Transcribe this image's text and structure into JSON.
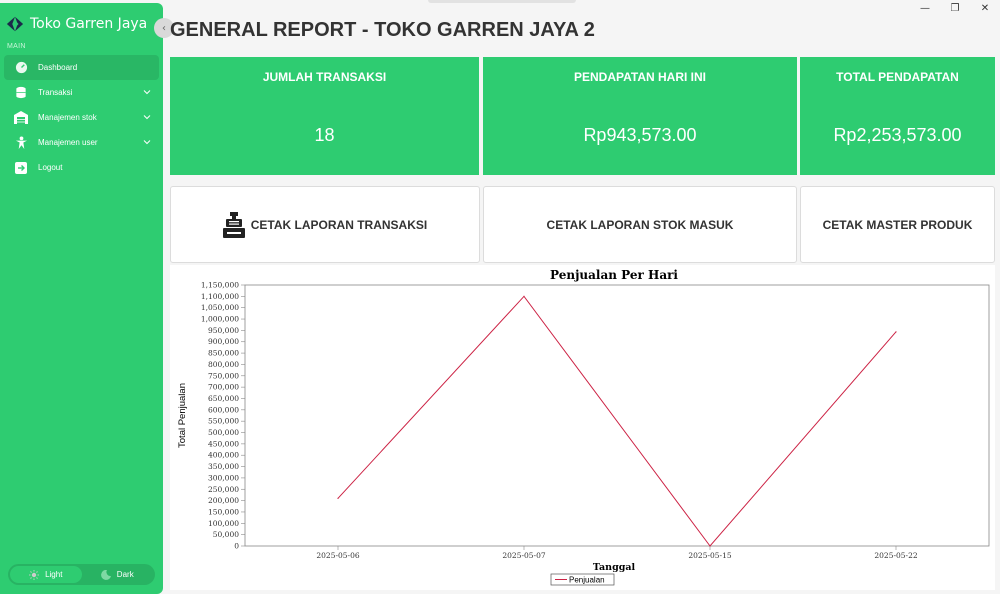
{
  "window": {
    "minimize": "—",
    "restore": "❐",
    "close": "✕"
  },
  "sidebar": {
    "brand": "Toko Garren Jaya",
    "section_label": "MAIN",
    "items": [
      {
        "label": "Dashboard",
        "icon": "dashboard-icon"
      },
      {
        "label": "Transaksi",
        "icon": "database-icon"
      },
      {
        "label": "Manajemen stok",
        "icon": "warehouse-icon"
      },
      {
        "label": "Manajemen user",
        "icon": "user-icon"
      },
      {
        "label": "Logout",
        "icon": "logout-icon"
      }
    ],
    "theme": {
      "light": "Light",
      "dark": "Dark"
    }
  },
  "page": {
    "title": "GENERAL REPORT - TOKO GARREN JAYA 2"
  },
  "stats": [
    {
      "label": "JUMLAH TRANSAKSI",
      "value": "18"
    },
    {
      "label": "PENDAPATAN HARI INI",
      "value": "Rp943,573.00"
    },
    {
      "label": "TOTAL PENDAPATAN",
      "value": "Rp2,253,573.00"
    }
  ],
  "actions": [
    {
      "label": "CETAK LAPORAN TRANSAKSI",
      "icon": "cash-register-icon"
    },
    {
      "label": "CETAK LAPORAN STOK MASUK"
    },
    {
      "label": "CETAK MASTER PRODUK"
    }
  ],
  "colors": {
    "accent": "#2ecc71",
    "series": "#cc2244"
  },
  "chart_data": {
    "type": "line",
    "title": "Penjualan Per Hari",
    "xlabel": "Tanggal",
    "ylabel": "Total Penjualan",
    "categories": [
      "2025-05-06",
      "2025-05-07",
      "2025-05-15",
      "2025-05-22"
    ],
    "series": [
      {
        "name": "Penjualan",
        "values": [
          210000,
          1100000,
          0,
          943573
        ]
      }
    ],
    "ylim": [
      0,
      1150000
    ],
    "ytick_step": 50000,
    "legend": "bottom"
  }
}
